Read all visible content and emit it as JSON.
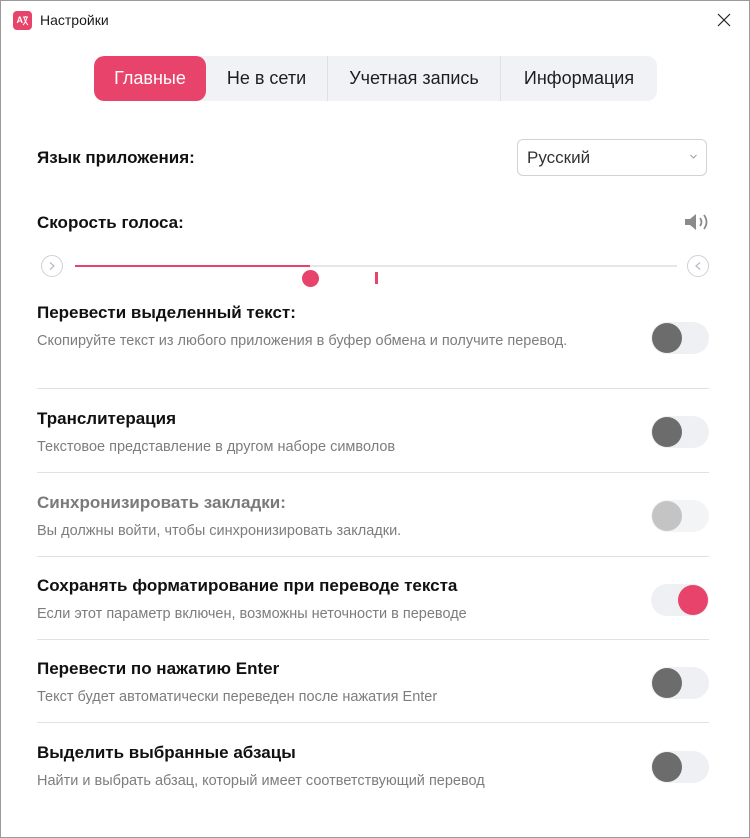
{
  "window": {
    "title": "Настройки"
  },
  "tabs": [
    {
      "label": "Главные",
      "active": true
    },
    {
      "label": "Не в сети",
      "active": false
    },
    {
      "label": "Учетная запись",
      "active": false
    },
    {
      "label": "Информация",
      "active": false
    }
  ],
  "language": {
    "label": "Язык приложения:",
    "value": "Русский"
  },
  "voice_speed": {
    "label": "Скорость голоса:",
    "value_fraction": 0.39,
    "default_fraction": 0.5
  },
  "settings": [
    {
      "title": "Перевести выделенный текст:",
      "desc": "Скопируйте текст из любого приложения в буфер обмена и получите перевод.",
      "state": "off"
    },
    {
      "title": "Транслитерация",
      "desc": "Текстовое представление в другом наборе символов",
      "state": "off"
    },
    {
      "title": "Синхронизировать закладки:",
      "desc": "Вы должны войти, чтобы синхронизировать закладки.",
      "state": "disabled"
    },
    {
      "title": "Сохранять форматирование при переводе текста",
      "desc": "Если этот параметр включен, возможны неточности в переводе",
      "state": "on"
    },
    {
      "title": "Перевести по нажатию Enter",
      "desc": "Текст будет автоматически переведен после нажатия Enter",
      "state": "off"
    },
    {
      "title": "Выделить выбранные абзацы",
      "desc": "Найти и выбрать абзац, который имеет соответствующий перевод",
      "state": "off"
    }
  ],
  "colors": {
    "accent": "#e8436a",
    "muted": "#7d7d7d"
  },
  "icons": {
    "app": "translate-app-icon",
    "close": "close-icon",
    "speaker": "speaker-icon",
    "slower": "slower-icon",
    "faster": "faster-icon",
    "dropdown": "chevron-down-icon"
  }
}
